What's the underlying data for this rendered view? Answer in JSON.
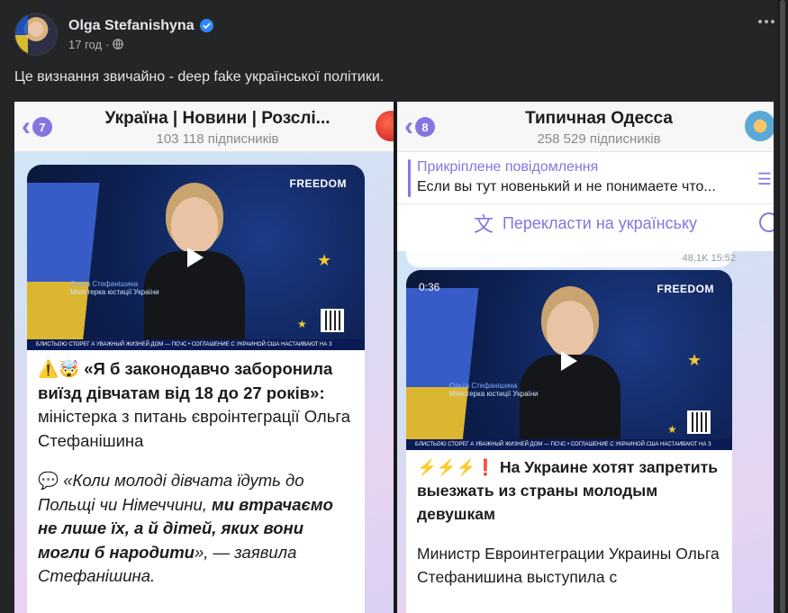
{
  "post": {
    "author": "Olga Stefanishyna",
    "time": "17 год",
    "text": "Це визнання звичайно - deep fake української політики."
  },
  "left": {
    "back_count": "7",
    "channel_title": "Україна | Новини | Розслі...",
    "subscribers": "103 118 підписників",
    "video": {
      "logo": "FREEDOM",
      "name": "Ольга Стефанішина",
      "role": "Міністерка юстиції України",
      "ticker": "БЛИСТЬОЮ СТОРЕГ А УВАЖНЫЙ ЖИЗНЕЙ ДОМ — ПСЧС • СОГЛАШЕНИЕ С УКРАИНОЙ США НАСТАИВАЮТ НА З"
    },
    "message": {
      "emoji": "⚠️🤯",
      "quote_bold": "«Я б законодавчо заборонила виїзд дівчатам від 18 до 27 років»:",
      "quote_rest": " міністерка з питань євроінтеграції Ольга Стефанішина",
      "speech_emoji": "💬",
      "q2_start": "«Коли молоді дівчата їдуть до Польщі чи Німеччини, ",
      "q2_bold": "ми втрачаємо не лише їх, а й дітей, яких вони могли б народити",
      "q2_end": "», — заявила Стефанішина."
    }
  },
  "right": {
    "back_count": "8",
    "channel_title": "Типичная Одесса",
    "subscribers": "258 529 підписників",
    "pinned_title": "Прикріплене повідомлення",
    "pinned_text": "Если вы тут новенький и не понимаете что...",
    "translate_label": "Перекласти на українську",
    "views": "48,1K 15:52",
    "video": {
      "duration": "0:36",
      "logo": "FREEDOM",
      "name": "Ольга Стефанішина",
      "role": "Міністерка юстиції України",
      "ticker": "БЛИСТЬОЮ СТОРЕГ А УВАЖНЫЙ ЖИЗНЕЙ ДОМ — ПСЧС • СОГЛАШЕНИЕ С УКРАИНОЙ США НАСТАИВАЮТ НА З"
    },
    "message": {
      "emoji": "⚡⚡⚡❗",
      "headline": "На Украине хотят запретить выезжать из страны молодым девушкам",
      "body": "Министр Евроинтеграции Украины Ольга Стефанишина выступила с"
    }
  },
  "colors": {
    "accent": "#8774e1",
    "facebook_bg": "#242526",
    "verified": "#2d88ff"
  }
}
